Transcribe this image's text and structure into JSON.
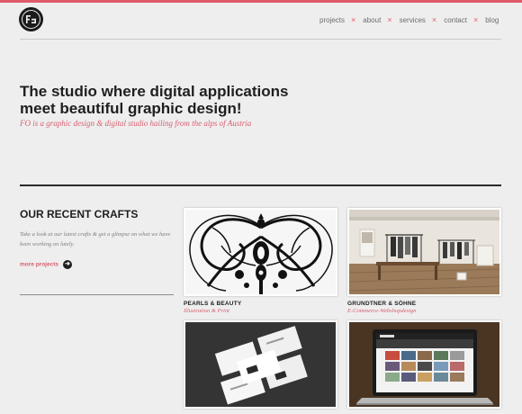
{
  "brand": {
    "logo_icon": "fo-logo-icon"
  },
  "nav": {
    "items": [
      "projects",
      "about",
      "services",
      "contact",
      "blog"
    ],
    "separator": "×"
  },
  "hero": {
    "headline_line1": "The studio where digital applications",
    "headline_line2": "meet beautiful graphic design!",
    "tagline": "FO is a graphic design & digital studio hailing from the alps of Austria"
  },
  "crafts": {
    "title": "OUR RECENT CRAFTS",
    "intro": "Take a look at our latest crafts & get a glimpse on what we have been working on lately.",
    "more_label": "more projects",
    "more_icon": "arrow-right-icon",
    "projects": [
      {
        "title": "PEARLS & BEAUTY",
        "subtitle": "Illustration & Print",
        "image": "ornamental-illustration"
      },
      {
        "title": "GRUNDTNER & SÖHNE",
        "subtitle": "E-Commerce-Webshopdesign",
        "image": "boutique-interior-photo"
      },
      {
        "title": "",
        "subtitle": "",
        "image": "business-cards-photo"
      },
      {
        "title": "",
        "subtitle": "",
        "image": "laptop-website-photo"
      }
    ]
  },
  "colors": {
    "accent": "#e05b6a",
    "text": "#1e1e1e",
    "background": "#efeeee"
  }
}
